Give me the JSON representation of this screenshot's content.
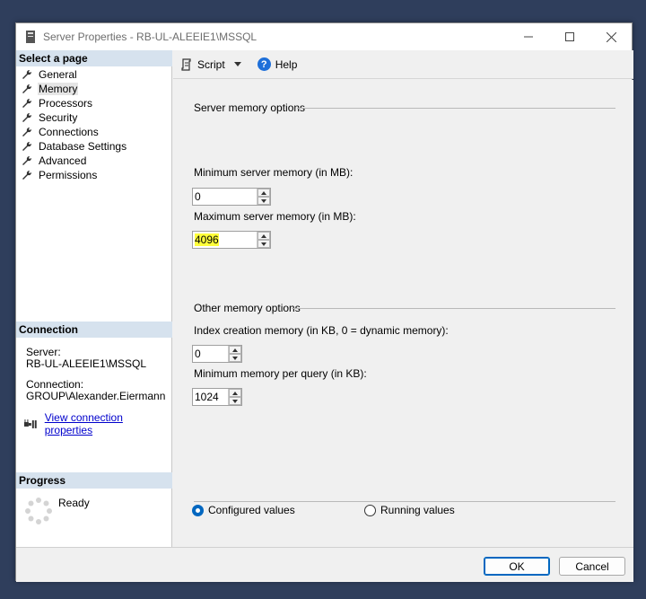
{
  "window": {
    "title": "Server Properties - RB-UL-ALEEIE1\\MSSQL"
  },
  "left_pane": {
    "select_page_header": "Select a page",
    "pages": [
      {
        "label": "General",
        "active": false
      },
      {
        "label": "Memory",
        "active": true
      },
      {
        "label": "Processors",
        "active": false
      },
      {
        "label": "Security",
        "active": false
      },
      {
        "label": "Connections",
        "active": false
      },
      {
        "label": "Database Settings",
        "active": false
      },
      {
        "label": "Advanced",
        "active": false
      },
      {
        "label": "Permissions",
        "active": false
      }
    ],
    "connection_header": "Connection",
    "server_label": "Server:",
    "server_value": "RB-UL-ALEEIE1\\MSSQL",
    "connection_label": "Connection:",
    "connection_value": "GROUP\\Alexander.Eiermann",
    "view_connection_link": "View connection properties",
    "progress_header": "Progress",
    "progress_status": "Ready"
  },
  "toolbar": {
    "script_label": "Script",
    "help_label": "Help"
  },
  "content": {
    "server_memory_group": "Server memory options",
    "min_server_memory_label": "Minimum server memory (in MB):",
    "min_server_memory_value": "0",
    "max_server_memory_label": "Maximum server memory (in MB):",
    "max_server_memory_value": "4096",
    "other_memory_group": "Other memory options",
    "index_creation_label": "Index creation memory (in KB, 0 = dynamic memory):",
    "index_creation_value": "0",
    "min_query_label": "Minimum memory per query (in KB):",
    "min_query_value": "1024",
    "configured_values_label": "Configured values",
    "running_values_label": "Running values",
    "selected_radio": "configured"
  },
  "footer": {
    "ok_label": "OK",
    "cancel_label": "Cancel"
  },
  "colors": {
    "section_header_bg": "#d6e2ee",
    "highlight": "#ffff3a",
    "accent": "#0067c0",
    "link": "#0000cc"
  }
}
